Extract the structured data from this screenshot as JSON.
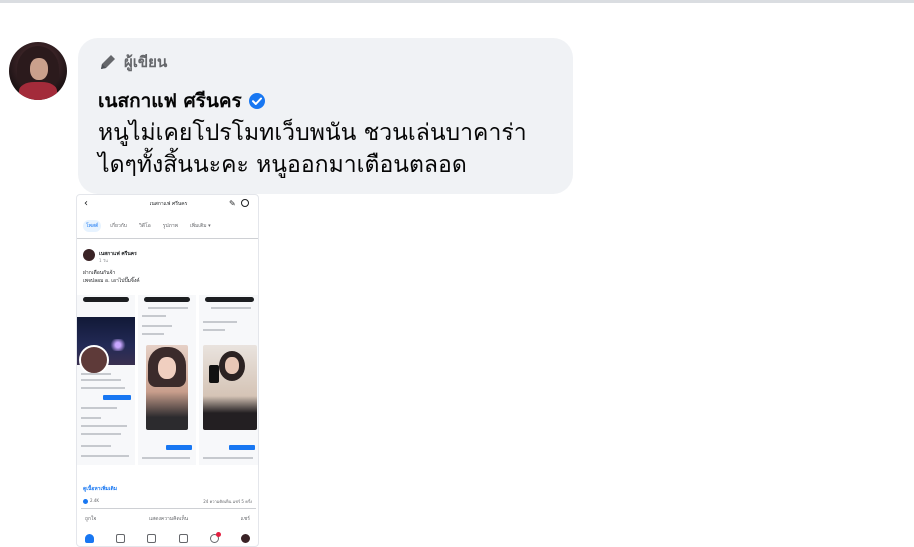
{
  "comment": {
    "badge": {
      "label": "ผู้เขียน",
      "icon": "pencil-icon"
    },
    "author": {
      "name": "เนสกาแฟ ศรีนคร",
      "verified": true,
      "icon": "verified-badge-icon"
    },
    "text": "หนูไม่เคยโปรโมทเว็บพนัน ชวนเล่นบาคาร่า ไดๆทั้งสิ้นนะคะ หนูออกมาเตือนตลอด"
  },
  "attachment": {
    "title": "เนสกาแฟ ศรีนคร",
    "tabs": [
      "โพสต์",
      "เกี่ยวกับ",
      "วิดีโอ",
      "รูปภาพ",
      "เพิ่มเติม ▾"
    ],
    "post": {
      "name": "เนสกาแฟ ศรีนคร",
      "time": "1 วัน",
      "line1": "ฝากเตือนกันจ้า",
      "line2": "เพจปลอม อ. เอาไปปั๊มจิ๊งค์"
    },
    "link": "ดูเนื้อหาเพิ่มเติม",
    "reactions": "2.4K",
    "stats": "24 ความคิดเห็น แชร์ 5 ครั้ง",
    "actions": [
      "ถูกใจ",
      "แสดงความคิดเห็น",
      "แชร์"
    ]
  },
  "colors": {
    "accent": "#1877f2",
    "bubble": "#f0f2f5",
    "muted": "#65676b"
  }
}
